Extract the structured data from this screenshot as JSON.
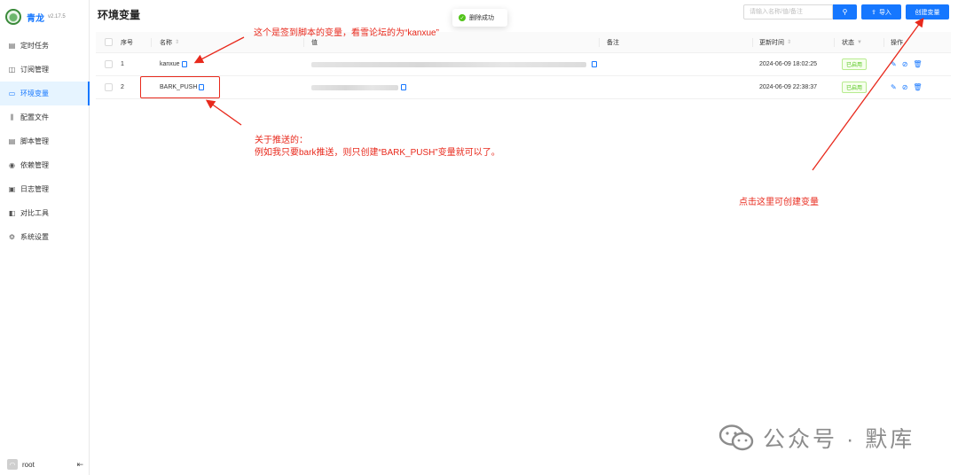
{
  "app": {
    "title": "青龙",
    "version": "v2.17.5"
  },
  "sidebar": {
    "items": [
      {
        "label": "定时任务",
        "icon": "clock-icon",
        "active": false
      },
      {
        "label": "订阅管理",
        "icon": "subscription-icon",
        "active": false
      },
      {
        "label": "环境变量",
        "icon": "env-icon",
        "active": true
      },
      {
        "label": "配置文件",
        "icon": "config-icon",
        "active": false
      },
      {
        "label": "脚本管理",
        "icon": "script-icon",
        "active": false
      },
      {
        "label": "依赖管理",
        "icon": "dependency-icon",
        "active": false
      },
      {
        "label": "日志管理",
        "icon": "log-icon",
        "active": false
      },
      {
        "label": "对比工具",
        "icon": "diff-icon",
        "active": false
      },
      {
        "label": "系统设置",
        "icon": "settings-icon",
        "active": false
      }
    ],
    "user": "root"
  },
  "header": {
    "title": "环境变量",
    "search_placeholder": "请输入名称/值/备注",
    "import_label": "导入",
    "create_label": "创建变量"
  },
  "toast": {
    "message": "删除成功"
  },
  "table": {
    "columns": {
      "index": "序号",
      "name": "名称",
      "value": "值",
      "remark": "备注",
      "updated": "更新时间",
      "status": "状态",
      "actions": "操作"
    },
    "rows": [
      {
        "index": "1",
        "name": "kanxue",
        "updated": "2024-06-09 18:02:25",
        "status": "已启用"
      },
      {
        "index": "2",
        "name": "BARK_PUSH",
        "updated": "2024-06-09 22:38:37",
        "status": "已启用"
      }
    ]
  },
  "annotations": {
    "top": "这个是签到脚本的变量，看雪论坛的为“kanxue”",
    "middle_line1": "关于推送的：",
    "middle_line2": "例如我只要bark推送，则只创建“BARK_PUSH”变量就可以了。",
    "right": "点击这里可创建变量"
  },
  "watermark": {
    "text": "公众号 · 默库"
  },
  "colors": {
    "accent": "#1677ff",
    "annotation": "#e8291c",
    "success": "#52c41a"
  }
}
